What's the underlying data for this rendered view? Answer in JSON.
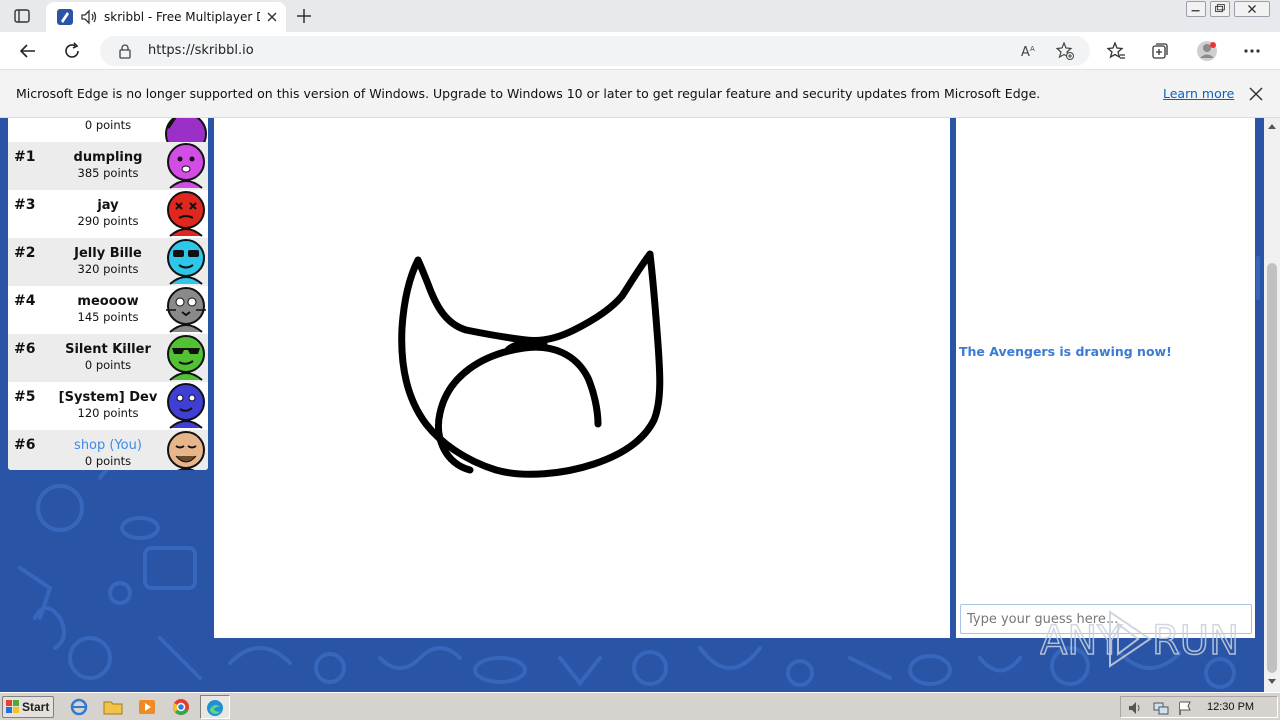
{
  "browser": {
    "tab_title": "skribbl - Free Multiplayer Dr",
    "url": "https://skribbl.io"
  },
  "infobar": {
    "message": "Microsoft Edge is no longer supported on this version of Windows. Upgrade to Windows 10 or later to get regular feature and security updates from Microsoft Edge.",
    "learn_more": "Learn more"
  },
  "players": [
    {
      "rank": "",
      "name": "",
      "points": "0 points",
      "avatar_color": "#9b30c8"
    },
    {
      "rank": "#1",
      "name": "dumpling",
      "points": "385 points",
      "avatar_color": "#d34ce6"
    },
    {
      "rank": "#3",
      "name": "jay",
      "points": "290 points",
      "avatar_color": "#e0271f"
    },
    {
      "rank": "#2",
      "name": "Jelly Bille",
      "points": "320 points",
      "avatar_color": "#2ec6e9"
    },
    {
      "rank": "#4",
      "name": "meooow",
      "points": "145 points",
      "avatar_color": "#8a8a8a"
    },
    {
      "rank": "#6",
      "name": "Silent Killer",
      "points": "0 points",
      "avatar_color": "#52c234"
    },
    {
      "rank": "#5",
      "name": "[System] Dev",
      "points": "120 points",
      "avatar_color": "#3f3fd6"
    },
    {
      "rank": "#6",
      "name": "shop (You)",
      "points": "0 points",
      "avatar_color": "#e8b48a"
    }
  ],
  "chat": {
    "system_message": "The Avengers is drawing now!",
    "guess_placeholder": "Type your guess here..."
  },
  "watermark": "ANY RUN",
  "taskbar": {
    "start_label": "Start",
    "clock": "12:30 PM"
  }
}
